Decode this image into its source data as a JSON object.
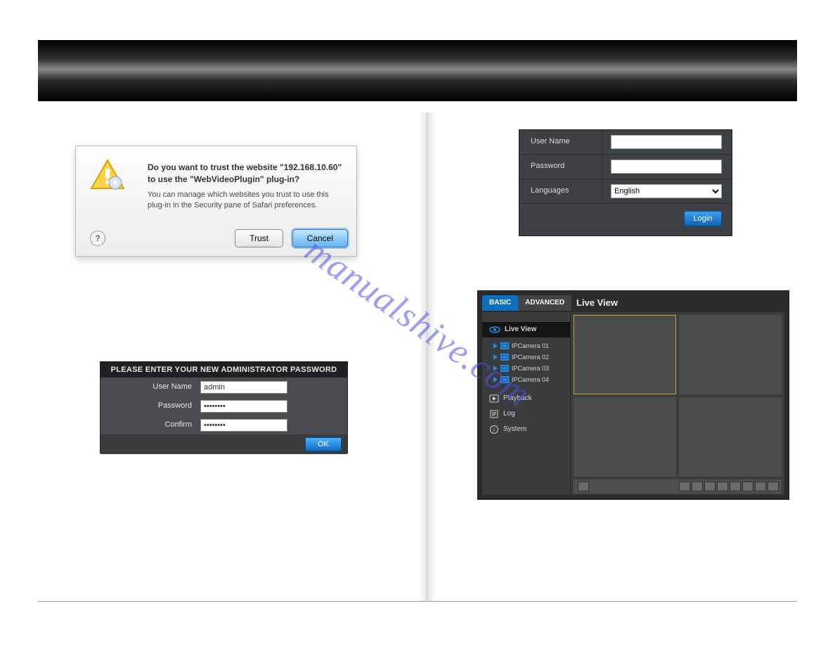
{
  "watermark": "manualshive.com",
  "safari_dialog": {
    "heading": "Do you want to trust the website \"192.168.10.60\" to use the \"WebVideoPlugin\" plug-in?",
    "body": "You can manage which websites you trust to use this plug-in in the Security pane of Safari preferences.",
    "trust_label": "Trust",
    "cancel_label": "Cancel",
    "help_label": "?"
  },
  "login": {
    "user_name_label": "User Name",
    "user_name_value": "",
    "password_label": "Password",
    "password_value": "",
    "languages_label": "Languages",
    "languages_value": "English",
    "login_button": "Login"
  },
  "admin_password": {
    "title": "PLEASE ENTER YOUR NEW ADMINISTRATOR PASSWORD",
    "user_name_label": "User Name",
    "user_name_value": "admin",
    "password_label": "Password",
    "password_value": "••••••••",
    "confirm_label": "Confirm",
    "confirm_value": "••••••••",
    "ok_button": "OK"
  },
  "liveview": {
    "tab_basic": "BASIC",
    "tab_advanced": "ADVANCED",
    "title": "Live View",
    "nav_liveview": "Live View",
    "cameras": [
      "IPCamera 01",
      "IPCamera 02",
      "IPCamera 03",
      "IPCamera 04"
    ],
    "nav_playback": "Playback",
    "nav_log": "Log",
    "nav_system": "System"
  }
}
